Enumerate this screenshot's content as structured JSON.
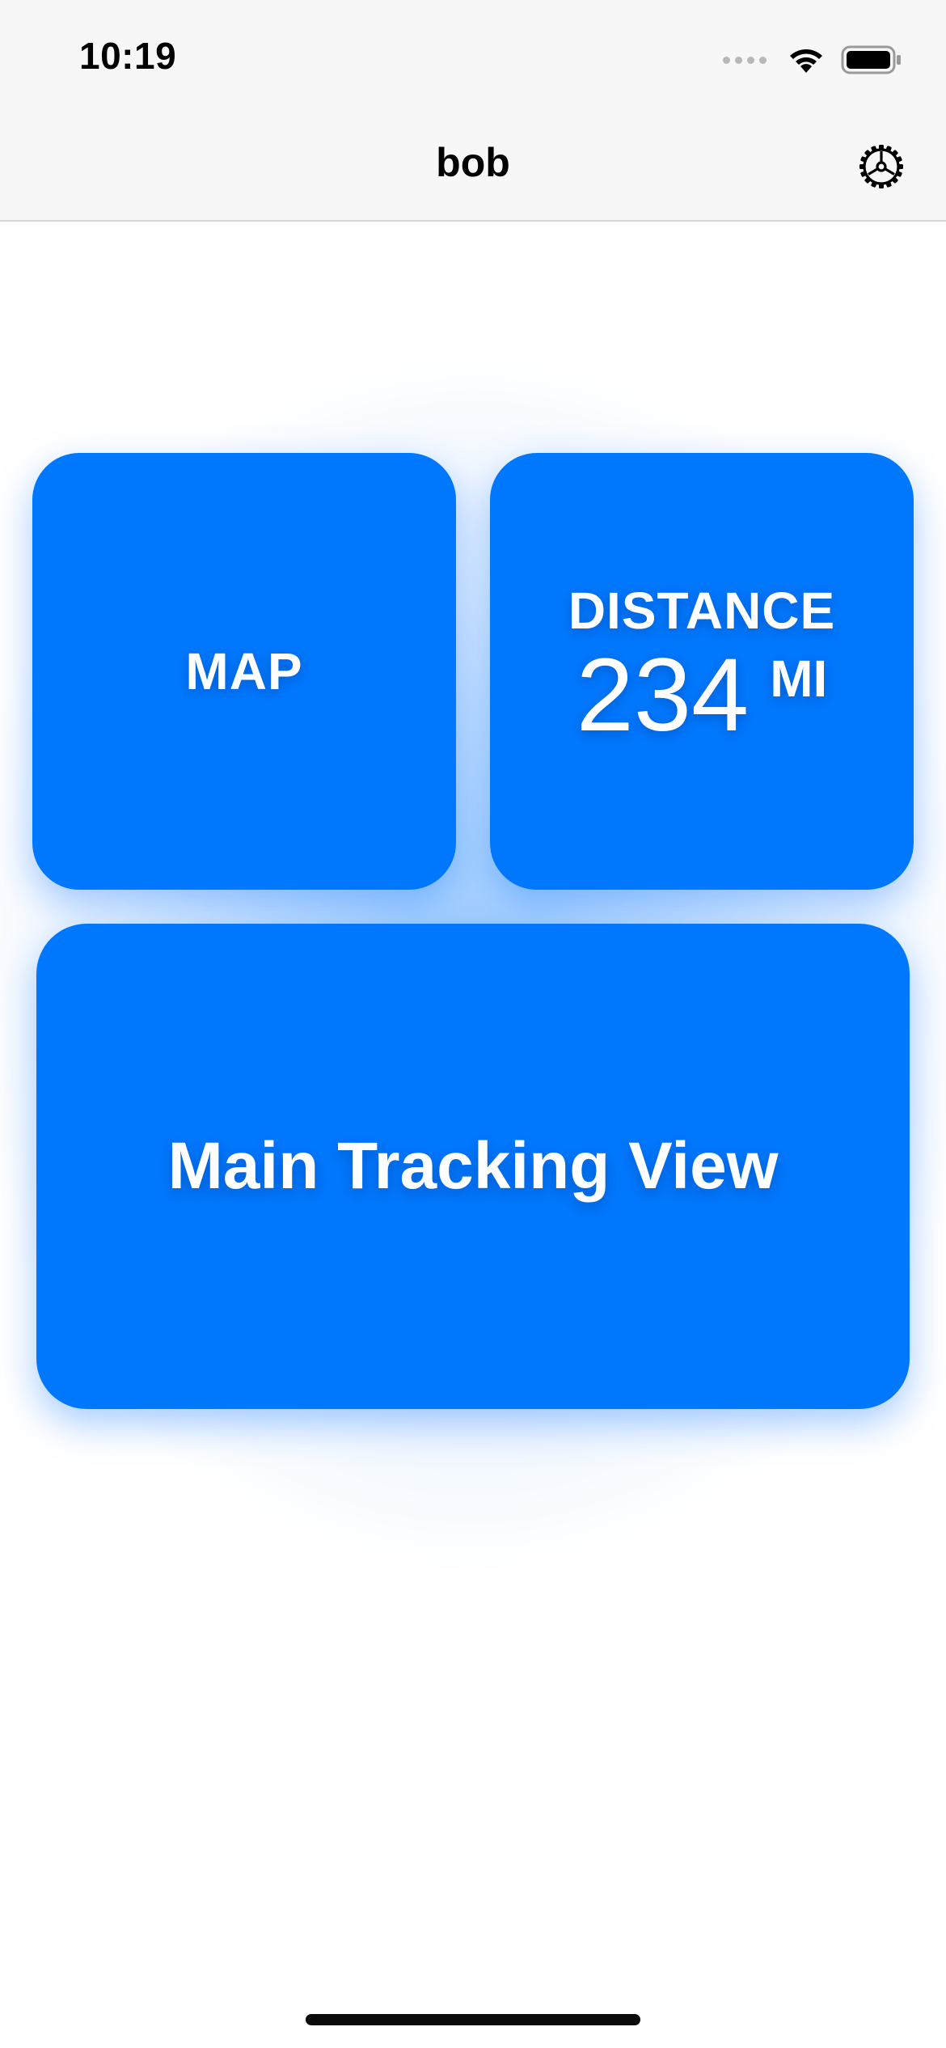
{
  "status_bar": {
    "time": "10:19",
    "icons": [
      "cellular-signal-icon",
      "wifi-icon",
      "battery-icon"
    ]
  },
  "nav_bar": {
    "title": "bob",
    "settings_icon": "gear-icon"
  },
  "tiles": {
    "map": {
      "label": "MAP"
    },
    "distance": {
      "label": "DISTANCE",
      "value": "234",
      "unit": "MI"
    },
    "main_tracking": {
      "label": "Main Tracking View"
    }
  },
  "colors": {
    "tile_background": "#0078fd",
    "tile_text": "#ffffff",
    "nav_background": "#f7f7f7"
  }
}
